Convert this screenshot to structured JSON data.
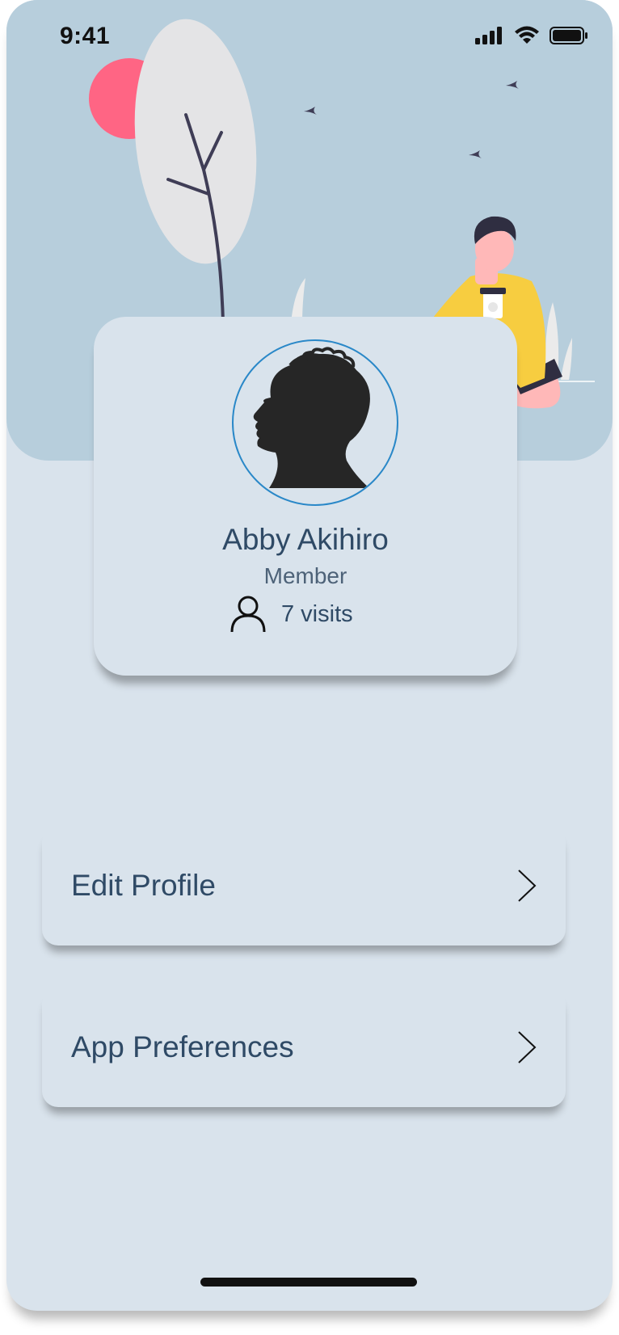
{
  "status_bar": {
    "time": "9:41",
    "icons": [
      "cellular-signal-icon",
      "wifi-icon",
      "battery-icon"
    ]
  },
  "hero": {
    "illustration": "person-with-coffee-under-tree",
    "colors": {
      "background": "#b7cedc",
      "sun": "#ff6584",
      "shirt": "#f7cd40"
    }
  },
  "profile": {
    "name": "Abby Akihiro",
    "role": "Member",
    "visits": "7 visits",
    "avatar_icon": "profile-silhouette-icon",
    "visits_icon": "user-icon"
  },
  "menu": {
    "items": [
      {
        "label": "Edit Profile",
        "icon": "chevron-right-icon"
      },
      {
        "label": "App Preferences",
        "icon": "chevron-right-icon"
      }
    ]
  },
  "colors": {
    "page_background": "#d9e3ec",
    "text_primary": "#2f4a66",
    "avatar_ring": "#2a88c8"
  }
}
